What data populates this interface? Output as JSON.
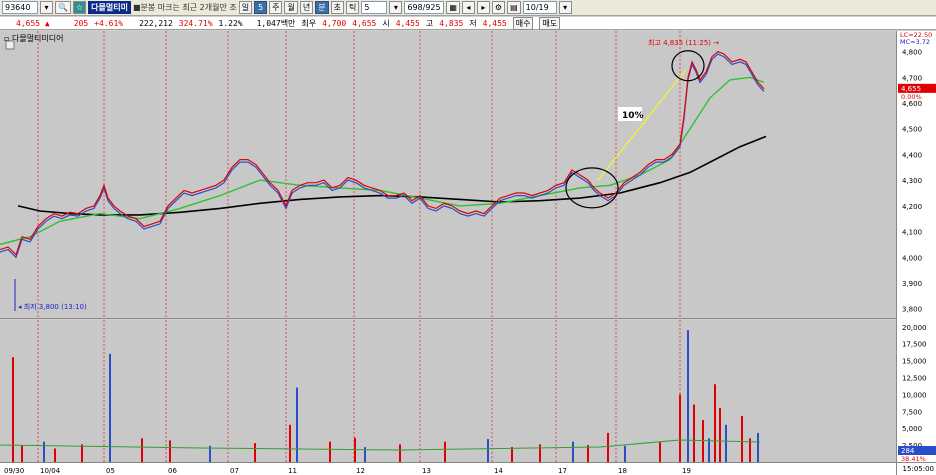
{
  "toolbar": {
    "code": "93640",
    "name": "다믈멀티미",
    "chart_type_label": "■분봉 마크는 최근 2개월만 조",
    "interval_label": "일",
    "interval_value": "5",
    "period_buttons": [
      "주",
      "월",
      "년",
      "분",
      "초",
      "틱"
    ],
    "active_period": "분",
    "minute_value": "5",
    "count_value": "698/925",
    "date_value": "10/19"
  },
  "quote": {
    "price": "4,655 ▲",
    "change": "205",
    "change_pct": "+4.61%",
    "volume": "222,212",
    "volume_ratio": "324.71%",
    "turnover_rate": "1.22%",
    "trade_value": "1,047백만",
    "prev_label": "최우",
    "prev_value": "4,700",
    "cur_value": "4,655",
    "open_label": "시",
    "open_value": "4,455",
    "high_label": "고",
    "high_value": "4,835",
    "low_label": "저",
    "low_value": "4,455",
    "buy_label": "매수",
    "sell_label": "매도"
  },
  "legend": {
    "name": "다믈멀티미디어"
  },
  "annotations": {
    "high_label": "최고 4,835 (11:25)",
    "low_label": "최저 3,800 (13:10)",
    "pct_label": "10%",
    "lc_label": "LC=22.50",
    "mc_label": "MC=3.72",
    "price_tag": "4,655",
    "pct_tag": "0.00%",
    "vol_tag": "284",
    "vol_pct_tag": "38.41%",
    "time_label": "15:05:00"
  },
  "colors": {
    "price_line": "#e00000",
    "ma_short": "#2a4ec8",
    "ma_mid": "#30c030",
    "ma_long": "#000000",
    "volume_up": "#e00000",
    "volume_down": "#2a4ec8"
  },
  "chart_data": {
    "type": "line",
    "price_axis": {
      "ticks": [
        "4,800",
        "4,700",
        "4,600",
        "4,500",
        "4,400",
        "4,300",
        "4,200",
        "4,100",
        "4,000",
        "3,900",
        "3,800"
      ],
      "ylim": [
        3760,
        4880
      ]
    },
    "volume_axis": {
      "ticks": [
        "20,000",
        "17,500",
        "15,000",
        "12,500",
        "10,000",
        "7,500",
        "5,000",
        "2,500"
      ],
      "ylim": [
        0,
        21000
      ]
    },
    "x_labels": [
      "09/30",
      "10/04",
      "05",
      "06",
      "07",
      "11",
      "12",
      "13",
      "14",
      "17",
      "18",
      "19"
    ],
    "price_series": [
      [
        0,
        4030
      ],
      [
        8,
        4040
      ],
      [
        16,
        4010
      ],
      [
        22,
        4080
      ],
      [
        30,
        4070
      ],
      [
        38,
        4120
      ],
      [
        46,
        4150
      ],
      [
        54,
        4170
      ],
      [
        62,
        4160
      ],
      [
        70,
        4175
      ],
      [
        78,
        4170
      ],
      [
        86,
        4190
      ],
      [
        94,
        4200
      ],
      [
        100,
        4240
      ],
      [
        104,
        4280
      ],
      [
        108,
        4230
      ],
      [
        114,
        4200
      ],
      [
        120,
        4180
      ],
      [
        128,
        4160
      ],
      [
        136,
        4150
      ],
      [
        144,
        4120
      ],
      [
        152,
        4130
      ],
      [
        160,
        4140
      ],
      [
        168,
        4200
      ],
      [
        176,
        4230
      ],
      [
        184,
        4260
      ],
      [
        192,
        4250
      ],
      [
        200,
        4260
      ],
      [
        208,
        4270
      ],
      [
        216,
        4280
      ],
      [
        224,
        4300
      ],
      [
        232,
        4350
      ],
      [
        240,
        4380
      ],
      [
        248,
        4380
      ],
      [
        256,
        4360
      ],
      [
        262,
        4330
      ],
      [
        270,
        4290
      ],
      [
        278,
        4260
      ],
      [
        286,
        4200
      ],
      [
        292,
        4260
      ],
      [
        300,
        4280
      ],
      [
        308,
        4290
      ],
      [
        316,
        4290
      ],
      [
        324,
        4300
      ],
      [
        332,
        4270
      ],
      [
        340,
        4280
      ],
      [
        348,
        4310
      ],
      [
        356,
        4300
      ],
      [
        364,
        4280
      ],
      [
        372,
        4270
      ],
      [
        380,
        4260
      ],
      [
        388,
        4240
      ],
      [
        396,
        4240
      ],
      [
        404,
        4250
      ],
      [
        412,
        4220
      ],
      [
        420,
        4240
      ],
      [
        428,
        4200
      ],
      [
        436,
        4190
      ],
      [
        444,
        4210
      ],
      [
        452,
        4200
      ],
      [
        460,
        4180
      ],
      [
        468,
        4170
      ],
      [
        476,
        4180
      ],
      [
        484,
        4170
      ],
      [
        492,
        4200
      ],
      [
        500,
        4230
      ],
      [
        508,
        4240
      ],
      [
        516,
        4250
      ],
      [
        524,
        4250
      ],
      [
        532,
        4240
      ],
      [
        540,
        4250
      ],
      [
        548,
        4260
      ],
      [
        556,
        4280
      ],
      [
        564,
        4290
      ],
      [
        572,
        4340
      ],
      [
        580,
        4320
      ],
      [
        588,
        4300
      ],
      [
        594,
        4270
      ],
      [
        600,
        4250
      ],
      [
        608,
        4230
      ],
      [
        616,
        4250
      ],
      [
        624,
        4290
      ],
      [
        632,
        4310
      ],
      [
        640,
        4330
      ],
      [
        648,
        4360
      ],
      [
        656,
        4380
      ],
      [
        664,
        4380
      ],
      [
        672,
        4400
      ],
      [
        680,
        4440
      ],
      [
        684,
        4550
      ],
      [
        688,
        4700
      ],
      [
        692,
        4760
      ],
      [
        696,
        4730
      ],
      [
        700,
        4690
      ],
      [
        706,
        4720
      ],
      [
        712,
        4780
      ],
      [
        718,
        4800
      ],
      [
        724,
        4790
      ],
      [
        732,
        4760
      ],
      [
        740,
        4770
      ],
      [
        746,
        4760
      ],
      [
        752,
        4720
      ],
      [
        758,
        4680
      ],
      [
        764,
        4655
      ]
    ],
    "ma_long_series": [
      [
        18,
        4200
      ],
      [
        40,
        4180
      ],
      [
        70,
        4170
      ],
      [
        100,
        4165
      ],
      [
        140,
        4165
      ],
      [
        180,
        4175
      ],
      [
        220,
        4190
      ],
      [
        260,
        4210
      ],
      [
        300,
        4225
      ],
      [
        340,
        4235
      ],
      [
        380,
        4240
      ],
      [
        420,
        4235
      ],
      [
        460,
        4225
      ],
      [
        500,
        4215
      ],
      [
        540,
        4220
      ],
      [
        580,
        4230
      ],
      [
        620,
        4250
      ],
      [
        660,
        4290
      ],
      [
        690,
        4330
      ],
      [
        720,
        4390
      ],
      [
        740,
        4430
      ],
      [
        766,
        4470
      ]
    ],
    "ma_mid_series": [
      [
        0,
        4050
      ],
      [
        30,
        4080
      ],
      [
        60,
        4140
      ],
      [
        100,
        4170
      ],
      [
        140,
        4150
      ],
      [
        180,
        4190
      ],
      [
        220,
        4240
      ],
      [
        260,
        4300
      ],
      [
        300,
        4280
      ],
      [
        340,
        4270
      ],
      [
        380,
        4260
      ],
      [
        420,
        4230
      ],
      [
        460,
        4200
      ],
      [
        500,
        4210
      ],
      [
        540,
        4240
      ],
      [
        580,
        4270
      ],
      [
        610,
        4280
      ],
      [
        640,
        4320
      ],
      [
        670,
        4380
      ],
      [
        690,
        4500
      ],
      [
        710,
        4620
      ],
      [
        730,
        4690
      ],
      [
        750,
        4700
      ],
      [
        764,
        4680
      ]
    ],
    "volume_spikes": [
      [
        13,
        15500
      ],
      [
        22,
        2500
      ],
      [
        44,
        3000
      ],
      [
        55,
        2000
      ],
      [
        82,
        2600
      ],
      [
        110,
        16000
      ],
      [
        142,
        3500
      ],
      [
        170,
        3200
      ],
      [
        210,
        2400
      ],
      [
        255,
        2800
      ],
      [
        290,
        5500
      ],
      [
        297,
        11000
      ],
      [
        330,
        3000
      ],
      [
        355,
        3600
      ],
      [
        365,
        2200
      ],
      [
        400,
        2600
      ],
      [
        445,
        3000
      ],
      [
        488,
        3400
      ],
      [
        512,
        2200
      ],
      [
        540,
        2600
      ],
      [
        573,
        3000
      ],
      [
        588,
        2500
      ],
      [
        608,
        4300
      ],
      [
        625,
        2400
      ],
      [
        660,
        3000
      ],
      [
        680,
        10000
      ],
      [
        688,
        19500
      ],
      [
        694,
        8500
      ],
      [
        703,
        6200
      ],
      [
        709,
        3500
      ],
      [
        715,
        11500
      ],
      [
        720,
        8000
      ],
      [
        726,
        5500
      ],
      [
        742,
        6800
      ],
      [
        750,
        3500
      ],
      [
        758,
        4300
      ]
    ]
  }
}
